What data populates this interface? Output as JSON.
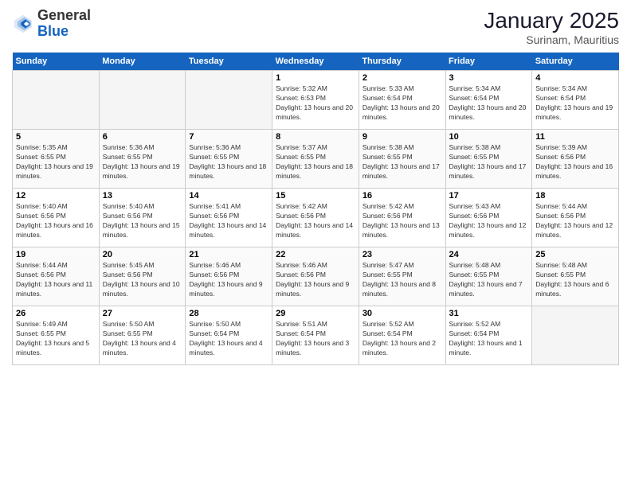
{
  "logo": {
    "general": "General",
    "blue": "Blue"
  },
  "header": {
    "title": "January 2025",
    "subtitle": "Surinam, Mauritius"
  },
  "weekdays": [
    "Sunday",
    "Monday",
    "Tuesday",
    "Wednesday",
    "Thursday",
    "Friday",
    "Saturday"
  ],
  "weeks": [
    [
      {
        "day": null
      },
      {
        "day": null
      },
      {
        "day": null
      },
      {
        "day": "1",
        "sunrise": "Sunrise: 5:32 AM",
        "sunset": "Sunset: 6:53 PM",
        "daylight": "Daylight: 13 hours and 20 minutes."
      },
      {
        "day": "2",
        "sunrise": "Sunrise: 5:33 AM",
        "sunset": "Sunset: 6:54 PM",
        "daylight": "Daylight: 13 hours and 20 minutes."
      },
      {
        "day": "3",
        "sunrise": "Sunrise: 5:34 AM",
        "sunset": "Sunset: 6:54 PM",
        "daylight": "Daylight: 13 hours and 20 minutes."
      },
      {
        "day": "4",
        "sunrise": "Sunrise: 5:34 AM",
        "sunset": "Sunset: 6:54 PM",
        "daylight": "Daylight: 13 hours and 19 minutes."
      }
    ],
    [
      {
        "day": "5",
        "sunrise": "Sunrise: 5:35 AM",
        "sunset": "Sunset: 6:55 PM",
        "daylight": "Daylight: 13 hours and 19 minutes."
      },
      {
        "day": "6",
        "sunrise": "Sunrise: 5:36 AM",
        "sunset": "Sunset: 6:55 PM",
        "daylight": "Daylight: 13 hours and 19 minutes."
      },
      {
        "day": "7",
        "sunrise": "Sunrise: 5:36 AM",
        "sunset": "Sunset: 6:55 PM",
        "daylight": "Daylight: 13 hours and 18 minutes."
      },
      {
        "day": "8",
        "sunrise": "Sunrise: 5:37 AM",
        "sunset": "Sunset: 6:55 PM",
        "daylight": "Daylight: 13 hours and 18 minutes."
      },
      {
        "day": "9",
        "sunrise": "Sunrise: 5:38 AM",
        "sunset": "Sunset: 6:55 PM",
        "daylight": "Daylight: 13 hours and 17 minutes."
      },
      {
        "day": "10",
        "sunrise": "Sunrise: 5:38 AM",
        "sunset": "Sunset: 6:55 PM",
        "daylight": "Daylight: 13 hours and 17 minutes."
      },
      {
        "day": "11",
        "sunrise": "Sunrise: 5:39 AM",
        "sunset": "Sunset: 6:56 PM",
        "daylight": "Daylight: 13 hours and 16 minutes."
      }
    ],
    [
      {
        "day": "12",
        "sunrise": "Sunrise: 5:40 AM",
        "sunset": "Sunset: 6:56 PM",
        "daylight": "Daylight: 13 hours and 16 minutes."
      },
      {
        "day": "13",
        "sunrise": "Sunrise: 5:40 AM",
        "sunset": "Sunset: 6:56 PM",
        "daylight": "Daylight: 13 hours and 15 minutes."
      },
      {
        "day": "14",
        "sunrise": "Sunrise: 5:41 AM",
        "sunset": "Sunset: 6:56 PM",
        "daylight": "Daylight: 13 hours and 14 minutes."
      },
      {
        "day": "15",
        "sunrise": "Sunrise: 5:42 AM",
        "sunset": "Sunset: 6:56 PM",
        "daylight": "Daylight: 13 hours and 14 minutes."
      },
      {
        "day": "16",
        "sunrise": "Sunrise: 5:42 AM",
        "sunset": "Sunset: 6:56 PM",
        "daylight": "Daylight: 13 hours and 13 minutes."
      },
      {
        "day": "17",
        "sunrise": "Sunrise: 5:43 AM",
        "sunset": "Sunset: 6:56 PM",
        "daylight": "Daylight: 13 hours and 12 minutes."
      },
      {
        "day": "18",
        "sunrise": "Sunrise: 5:44 AM",
        "sunset": "Sunset: 6:56 PM",
        "daylight": "Daylight: 13 hours and 12 minutes."
      }
    ],
    [
      {
        "day": "19",
        "sunrise": "Sunrise: 5:44 AM",
        "sunset": "Sunset: 6:56 PM",
        "daylight": "Daylight: 13 hours and 11 minutes."
      },
      {
        "day": "20",
        "sunrise": "Sunrise: 5:45 AM",
        "sunset": "Sunset: 6:56 PM",
        "daylight": "Daylight: 13 hours and 10 minutes."
      },
      {
        "day": "21",
        "sunrise": "Sunrise: 5:46 AM",
        "sunset": "Sunset: 6:56 PM",
        "daylight": "Daylight: 13 hours and 9 minutes."
      },
      {
        "day": "22",
        "sunrise": "Sunrise: 5:46 AM",
        "sunset": "Sunset: 6:56 PM",
        "daylight": "Daylight: 13 hours and 9 minutes."
      },
      {
        "day": "23",
        "sunrise": "Sunrise: 5:47 AM",
        "sunset": "Sunset: 6:55 PM",
        "daylight": "Daylight: 13 hours and 8 minutes."
      },
      {
        "day": "24",
        "sunrise": "Sunrise: 5:48 AM",
        "sunset": "Sunset: 6:55 PM",
        "daylight": "Daylight: 13 hours and 7 minutes."
      },
      {
        "day": "25",
        "sunrise": "Sunrise: 5:48 AM",
        "sunset": "Sunset: 6:55 PM",
        "daylight": "Daylight: 13 hours and 6 minutes."
      }
    ],
    [
      {
        "day": "26",
        "sunrise": "Sunrise: 5:49 AM",
        "sunset": "Sunset: 6:55 PM",
        "daylight": "Daylight: 13 hours and 5 minutes."
      },
      {
        "day": "27",
        "sunrise": "Sunrise: 5:50 AM",
        "sunset": "Sunset: 6:55 PM",
        "daylight": "Daylight: 13 hours and 4 minutes."
      },
      {
        "day": "28",
        "sunrise": "Sunrise: 5:50 AM",
        "sunset": "Sunset: 6:54 PM",
        "daylight": "Daylight: 13 hours and 4 minutes."
      },
      {
        "day": "29",
        "sunrise": "Sunrise: 5:51 AM",
        "sunset": "Sunset: 6:54 PM",
        "daylight": "Daylight: 13 hours and 3 minutes."
      },
      {
        "day": "30",
        "sunrise": "Sunrise: 5:52 AM",
        "sunset": "Sunset: 6:54 PM",
        "daylight": "Daylight: 13 hours and 2 minutes."
      },
      {
        "day": "31",
        "sunrise": "Sunrise: 5:52 AM",
        "sunset": "Sunset: 6:54 PM",
        "daylight": "Daylight: 13 hours and 1 minute."
      },
      {
        "day": null
      }
    ]
  ]
}
